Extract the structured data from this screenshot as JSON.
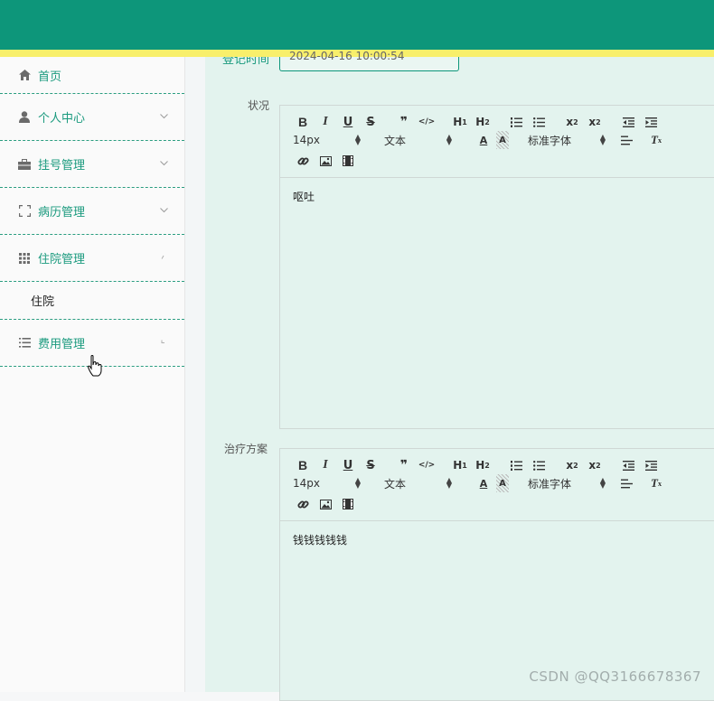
{
  "header": {
    "bg_color": "#0d967a",
    "stripe_color": "#f8ef6b"
  },
  "sidebar": {
    "items": [
      {
        "label": "首页",
        "icon": "home-icon"
      },
      {
        "label": "个人中心",
        "icon": "user-icon"
      },
      {
        "label": "挂号管理",
        "icon": "briefcase-icon"
      },
      {
        "label": "病历管理",
        "icon": "fullscreen-icon"
      },
      {
        "label": "住院管理",
        "icon": "grid-icon",
        "sub": [
          "住院"
        ]
      },
      {
        "label": "费用管理",
        "icon": "list-icon"
      }
    ]
  },
  "form": {
    "date_label": "登记时间",
    "date_value": "2024-04-16 10:00:54",
    "status_label": "状况",
    "status_content": "呕吐",
    "plan_label": "治疗方案",
    "plan_content": "钱钱钱钱钱"
  },
  "toolbar": {
    "row1": [
      "B",
      "I",
      "U",
      "S",
      "❞",
      "</>",
      "H1",
      "H2",
      "ol",
      "ul",
      "x₂",
      "x²",
      "outdent",
      "indent"
    ],
    "size": "14px",
    "para": "文本",
    "font": "标准字体"
  },
  "watermark": "CSDN @QQ3166678367"
}
